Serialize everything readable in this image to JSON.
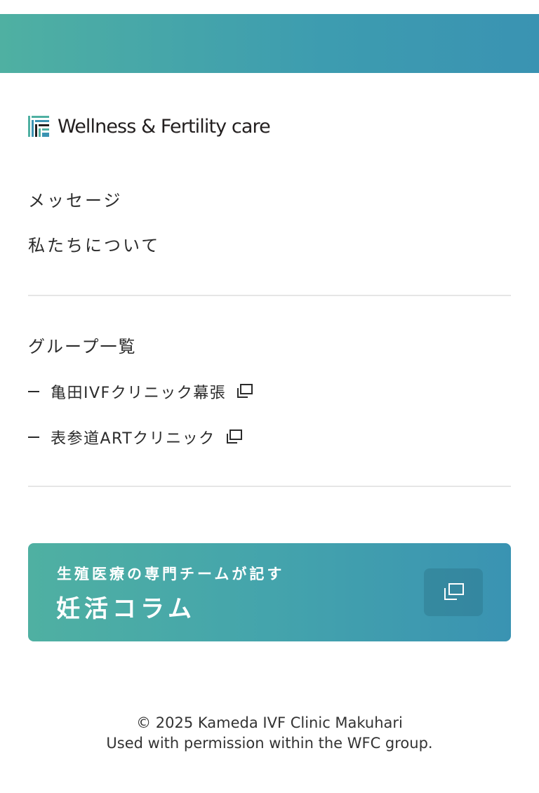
{
  "brand": {
    "logo_text": "Wellness & Fertility care",
    "logo_colors": [
      "#4fb0a2",
      "#3a93b2",
      "#231f1f"
    ]
  },
  "nav": {
    "items": [
      {
        "label": "メッセージ"
      },
      {
        "label": "私たちについて"
      }
    ]
  },
  "group": {
    "heading": "グループ一覧",
    "links": [
      {
        "label": "亀田IVFクリニック幕張",
        "icon": "external-link-icon"
      },
      {
        "label": "表参道ARTクリニック",
        "icon": "external-link-icon"
      }
    ]
  },
  "banner": {
    "subtitle": "生殖医療の専門チームが記す",
    "title": "妊活コラム",
    "icon": "external-link-icon"
  },
  "footer": {
    "copyright": "© 2025 Kameda IVF Clinic Makuhari",
    "permission": "Used with permission within the WFC group."
  },
  "colors": {
    "accent_start": "#4fb0a2",
    "accent_end": "#3a93b2",
    "text": "#2b2b2b",
    "divider": "#e6e6e6"
  }
}
